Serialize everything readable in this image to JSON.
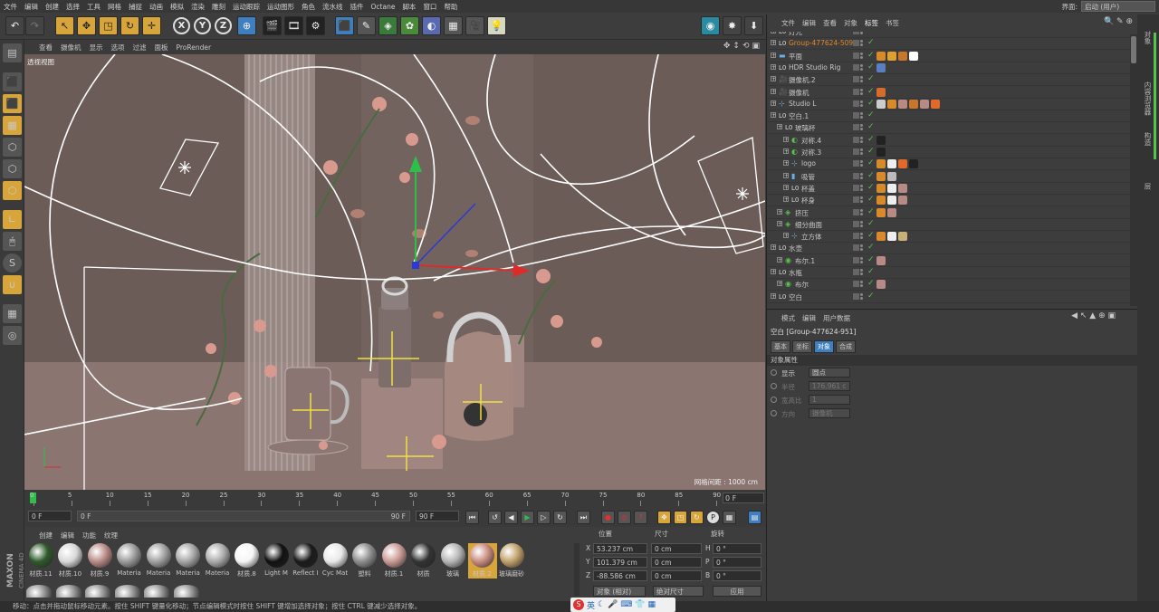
{
  "menu": [
    "文件",
    "编辑",
    "创建",
    "选择",
    "工具",
    "网格",
    "捕捉",
    "动画",
    "模拟",
    "渲染",
    "雕刻",
    "运动跟踪",
    "运动图形",
    "角色",
    "流水线",
    "插件",
    "Octane",
    "脚本",
    "窗口",
    "帮助"
  ],
  "interface": {
    "label": "界面:",
    "value": "启动 (用户)"
  },
  "toolbar_icons": [
    "undo-icon",
    "redo-icon",
    "live-select-icon",
    "move-icon",
    "scale-icon",
    "rotate-icon",
    "add-icon",
    "x-axis-icon",
    "y-axis-icon",
    "z-axis-icon",
    "world-coords-icon",
    "render-view-icon",
    "render-picture-icon",
    "edit-render-settings-icon",
    "cube-icon",
    "pen-icon",
    "subdivision-icon",
    "array-icon",
    "deformer-icon",
    "floor-icon",
    "camera-icon",
    "light-icon"
  ],
  "toolbar_xyz": [
    "X",
    "Y",
    "Z"
  ],
  "viewport_menu": [
    "查看",
    "摄像机",
    "显示",
    "选项",
    "过滤",
    "面板",
    "ProRender"
  ],
  "viewport_label": "透视视图",
  "grid_label": "网格间距 : 1000 cm",
  "timeline": {
    "ticks": [
      "0",
      "5",
      "10",
      "15",
      "20",
      "25",
      "30",
      "35",
      "40",
      "45",
      "50",
      "55",
      "60",
      "65",
      "70",
      "75",
      "80",
      "85",
      "90"
    ],
    "current_frame": "0 F",
    "start_field": "0 F",
    "range_start": "0 F",
    "range_end": "90 F",
    "end_field": "90 F"
  },
  "materials_menu": [
    "创建",
    "编辑",
    "功能",
    "纹理"
  ],
  "materials": [
    {
      "label": "材质.11",
      "color": "#2e5a2a"
    },
    {
      "label": "材质.10",
      "color": "#d8d8d8"
    },
    {
      "label": "材质.9",
      "color": "#b88a86"
    },
    {
      "label": "Materia",
      "color": "#9a9a9a"
    },
    {
      "label": "Materia",
      "color": "#a0a0a0"
    },
    {
      "label": "Materia",
      "color": "#a5a5a5"
    },
    {
      "label": "Materia",
      "color": "#aaaaaa"
    },
    {
      "label": "材质.8",
      "color": "#f5f5f5"
    },
    {
      "label": "Light M",
      "color": "#111111"
    },
    {
      "label": "Reflect I",
      "color": "#1a1a1a"
    },
    {
      "label": "Cyc Mat",
      "color": "#e8e8e8"
    },
    {
      "label": "塑料",
      "color": "#8c8c8c"
    },
    {
      "label": "材质.1",
      "color": "#c99a94"
    },
    {
      "label": "材质",
      "color": "#333333"
    },
    {
      "label": "玻璃",
      "color": "#b5b5b5"
    },
    {
      "label": "材质.2",
      "color": "#c88b7e"
    },
    {
      "label": "玻璃磨砂",
      "color": "#c0a06a"
    }
  ],
  "coords": {
    "headers": [
      "位置",
      "尺寸",
      "旋转"
    ],
    "rows": [
      {
        "axis": "X",
        "pos": "53.237 cm",
        "size": "0 cm",
        "rlabel": "H",
        "rot": "0 °"
      },
      {
        "axis": "Y",
        "pos": "101.379 cm",
        "size": "0 cm",
        "rlabel": "P",
        "rot": "0 °"
      },
      {
        "axis": "Z",
        "pos": "-88.586 cm",
        "size": "0 cm",
        "rlabel": "B",
        "rot": "0 °"
      }
    ],
    "mode": "对象 (相对)",
    "size_mode": "绝对尺寸",
    "apply": "应用"
  },
  "status": "移动：点击并拖动鼠标移动元素。按住 SHIFT 键量化移动；节点编辑模式时按住 SHIFT 键增加选择对象；按住 CTRL 键减少选择对象。",
  "object_tabs": [
    "文件",
    "编辑",
    "查看",
    "对象",
    "标签",
    "书签"
  ],
  "objects": [
    {
      "name": "灯光",
      "indent": 0,
      "icon": "null-icon",
      "orange": false,
      "tags": []
    },
    {
      "name": "Group-477624-509",
      "indent": 0,
      "icon": "null-icon",
      "orange": true,
      "tags": []
    },
    {
      "name": "平面",
      "indent": 0,
      "icon": "plane-icon",
      "orange": false,
      "tags": [
        "#d88a2a",
        "#e0a030",
        "#c8772a",
        "#ffffff"
      ]
    },
    {
      "name": "HDR Studio Rig",
      "indent": 0,
      "icon": "null-icon",
      "orange": false,
      "tags": [
        "#5a7fc0"
      ]
    },
    {
      "name": "摄像机.2",
      "indent": 0,
      "icon": "camera-icon",
      "orange": false,
      "tags": []
    },
    {
      "name": "摄像机",
      "indent": 0,
      "icon": "camera-icon",
      "orange": false,
      "tags": [
        "#d86a2a"
      ]
    },
    {
      "name": "Studio L",
      "indent": 0,
      "icon": "light-icon",
      "orange": false,
      "tags": [
        "#cccccc",
        "#d88a2a",
        "#b88a86",
        "#c8772a",
        "#b88a86",
        "#e06a2a"
      ]
    },
    {
      "name": "空白.1",
      "indent": 0,
      "icon": "null-icon",
      "orange": false,
      "tags": []
    },
    {
      "name": "玻璃杯",
      "indent": 1,
      "icon": "null-icon",
      "orange": false,
      "tags": []
    },
    {
      "name": "对称.4",
      "indent": 2,
      "icon": "symmetry-icon",
      "orange": false,
      "tags": [
        "#222222"
      ]
    },
    {
      "name": "对称.3",
      "indent": 2,
      "icon": "symmetry-icon",
      "orange": false,
      "tags": [
        "#222222"
      ]
    },
    {
      "name": "logo",
      "indent": 2,
      "icon": "light-icon",
      "orange": false,
      "tags": [
        "#d88a2a",
        "#eeeeee",
        "#e06a2a",
        "#222222"
      ]
    },
    {
      "name": "吸管",
      "indent": 2,
      "icon": "cylinder-icon",
      "orange": false,
      "tags": [
        "#d88a2a",
        "#bbbbbb"
      ]
    },
    {
      "name": "杯盖",
      "indent": 2,
      "icon": "null-icon",
      "orange": false,
      "tags": [
        "#d88a2a",
        "#eeeeee",
        "#b88a86"
      ]
    },
    {
      "name": "杯身",
      "indent": 2,
      "icon": "null-icon",
      "orange": false,
      "tags": [
        "#d88a2a",
        "#eeeeee",
        "#b88a86"
      ]
    },
    {
      "name": "挤压",
      "indent": 1,
      "icon": "extrude-icon",
      "orange": false,
      "tags": [
        "#d88a2a",
        "#b88a86"
      ]
    },
    {
      "name": "细分曲面",
      "indent": 1,
      "icon": "subdivision-icon",
      "orange": false,
      "tags": []
    },
    {
      "name": "立方体",
      "indent": 2,
      "icon": "light-icon",
      "orange": false,
      "tags": [
        "#d88a2a",
        "#eeeeee",
        "#c8b07a"
      ]
    },
    {
      "name": "水壶",
      "indent": 0,
      "icon": "null-icon",
      "orange": false,
      "tags": []
    },
    {
      "name": "布尔.1",
      "indent": 1,
      "icon": "boole-icon",
      "orange": false,
      "tags": [
        "#b88a86"
      ]
    },
    {
      "name": "水瓶",
      "indent": 0,
      "icon": "null-icon",
      "orange": false,
      "tags": []
    },
    {
      "name": "布尔",
      "indent": 1,
      "icon": "boole-icon",
      "orange": false,
      "tags": [
        "#b88a86"
      ]
    },
    {
      "name": "空白",
      "indent": 0,
      "icon": "null-icon",
      "orange": false,
      "tags": []
    }
  ],
  "attr_tabs": [
    "模式",
    "编辑",
    "用户数据"
  ],
  "attr_title": "空白 [Group-477624-951]",
  "attr_subtabs": [
    "基本",
    "坐标",
    "对象",
    "合成"
  ],
  "attr_section": "对象属性",
  "attr_rows": [
    {
      "label": "显示",
      "value": "圆点",
      "dim": false
    },
    {
      "label": "半径",
      "value": "176.961 c",
      "dim": true
    },
    {
      "label": "宽高比",
      "value": "1",
      "dim": true
    },
    {
      "label": "方向",
      "value": "摄像机",
      "dim": true
    }
  ],
  "right_tabs": [
    "对象",
    "内容浏览器",
    "构造",
    "层"
  ],
  "maxon": {
    "brand": "MAXON",
    "product": "CINEMA 4D"
  },
  "ime": {
    "lang": "英"
  }
}
